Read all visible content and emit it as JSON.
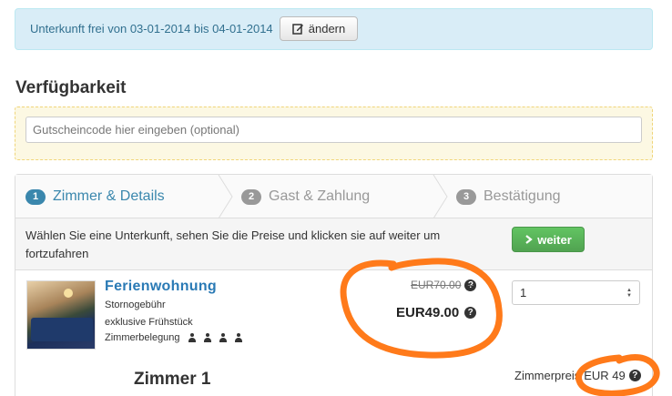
{
  "notice": {
    "text": "Unterkunft frei von 03-01-2014 bis 04-01-2014",
    "change_button": "ändern"
  },
  "section_title": "Verfügbarkeit",
  "voucher": {
    "placeholder": "Gutscheincode hier eingeben (optional)"
  },
  "steps": [
    {
      "number": "1",
      "label": "Zimmer & Details",
      "active": true
    },
    {
      "number": "2",
      "label": "Gast & Zahlung",
      "active": false
    },
    {
      "number": "3",
      "label": "Bestätigung",
      "active": false
    }
  ],
  "instruction": {
    "text": "Wählen Sie eine Unterkunft, sehen Sie die Preise und klicken sie auf weiter um fortzufahren",
    "next_button": "weiter"
  },
  "room": {
    "name": "Ferienwohnung",
    "cancellation": "Stornogebühr",
    "breakfast": "exklusive Frühstück",
    "occupancy_label": "Zimmerbelegung",
    "occupancy_count": 4,
    "old_price": "EUR70.00",
    "new_price": "EUR49.00",
    "quantity": "1",
    "heading": "Zimmer 1",
    "room_price_label": "Zimmerpreis",
    "room_price_value": "EUR 49"
  },
  "colors": {
    "accent": "#3a87ad",
    "link": "#2a7ab5",
    "success": "#51a351",
    "annotation": "#ff7a1a"
  },
  "icons": {
    "edit": "edit-icon",
    "next": "chevron-right-icon",
    "help": "question-circle-icon",
    "person": "person-icon"
  }
}
